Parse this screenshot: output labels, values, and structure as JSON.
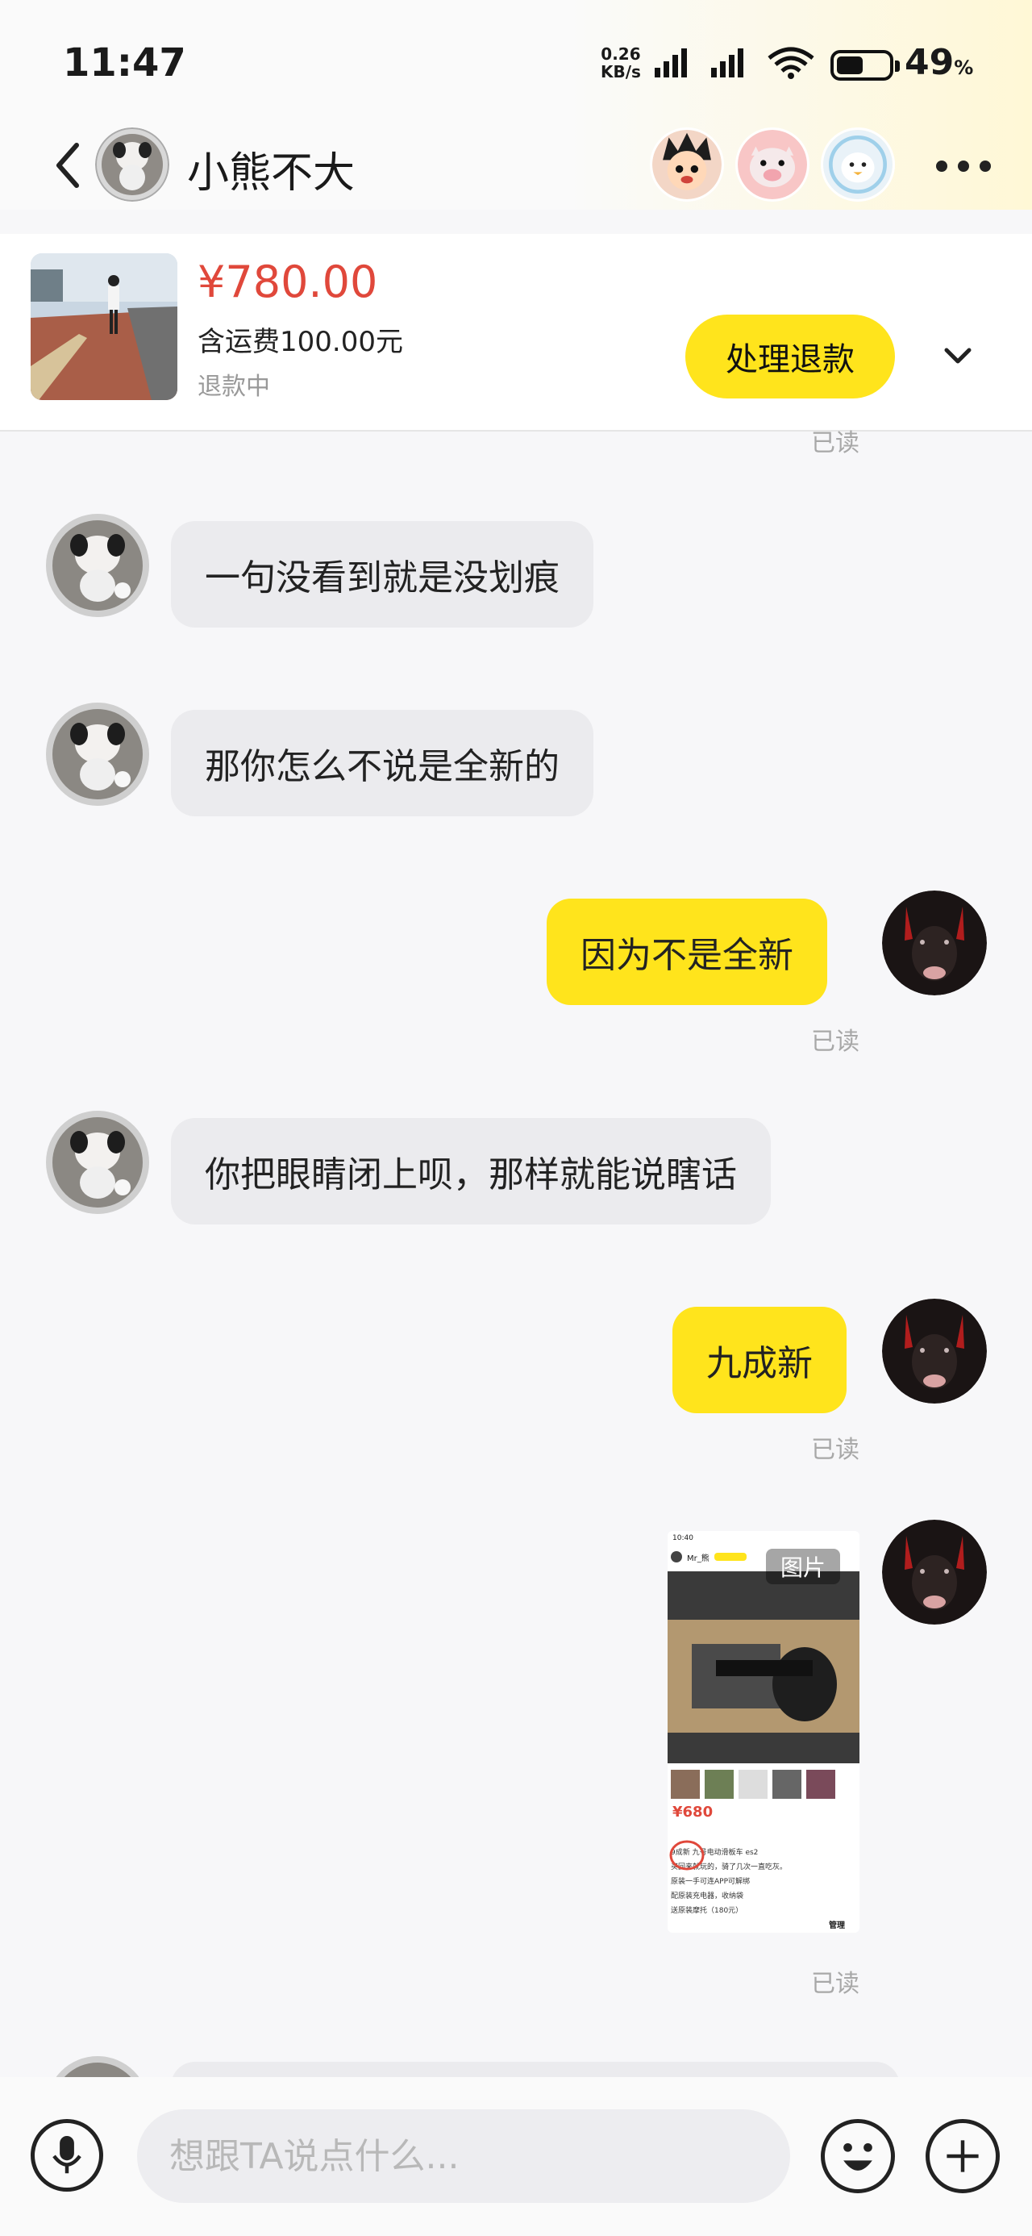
{
  "status_bar": {
    "time": "11:47",
    "net_speed_value": "0.26",
    "net_speed_unit": "KB/s",
    "battery_percent": "49",
    "battery_symbol": "%"
  },
  "header": {
    "contact_name": "小熊不大"
  },
  "product": {
    "price": "¥780.00",
    "shipping": "含运费100.00元",
    "status": "退款中",
    "action_label": "处理退款"
  },
  "messages": {
    "top_read": "已读",
    "m1": "一句没看到就是没划痕",
    "m2": "那你怎么不说是全新的",
    "m3": "因为不是全新",
    "m3_read": "已读",
    "m4": "你把眼睛闭上呗，那样就能说瞎话",
    "m5": "九成新",
    "m5_read": "已读",
    "image_label": "图片",
    "m6_read": "已读"
  },
  "shot": {
    "time": "10:40",
    "seller": "Mr_熊",
    "price": "¥680",
    "line1": "9成新 九号电动滑板车 es2",
    "line2": "买回来就玩的，骑了几次一直吃灰。",
    "line3": "原装一手可连APP可解绑",
    "line4": "配原装充电器，收纳袋",
    "line5": "送原装摩托（180元）",
    "manage": "管理"
  },
  "input": {
    "placeholder": "想跟TA说点什么..."
  },
  "colors": {
    "accent_yellow": "#ffe41c",
    "price_red": "#e0483b",
    "bubble_gray": "#ebebee"
  }
}
